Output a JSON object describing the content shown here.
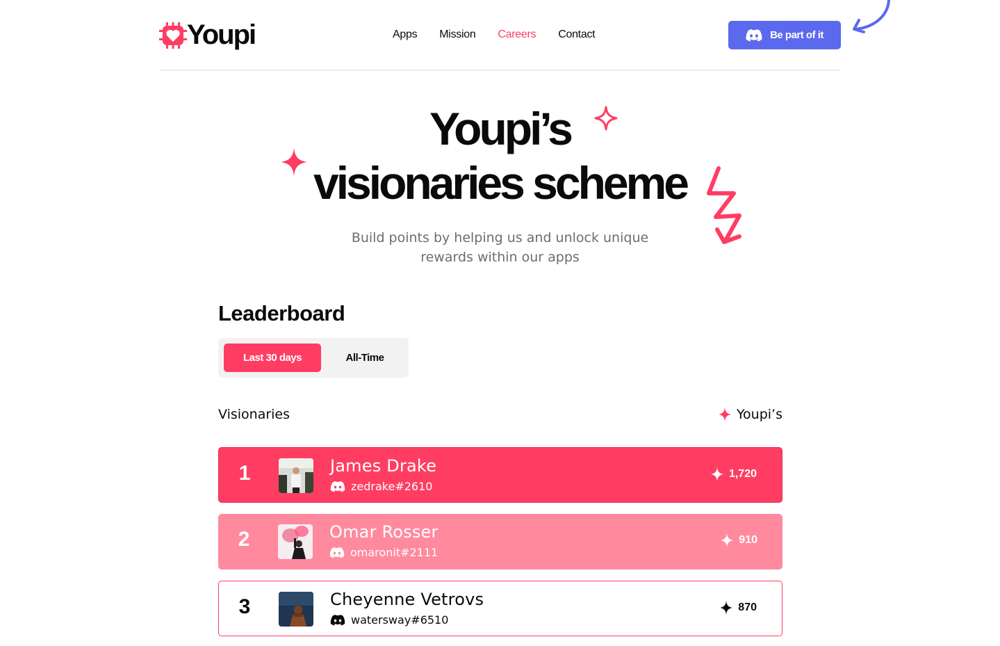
{
  "brand": {
    "name": "Youpi",
    "accent": "#ff3d63",
    "discord_color": "#5b69ee"
  },
  "nav": {
    "items": [
      {
        "label": "Apps",
        "active": false
      },
      {
        "label": "Mission",
        "active": false
      },
      {
        "label": "Careers",
        "active": true
      },
      {
        "label": "Contact",
        "active": false
      }
    ],
    "cta_label": "Be part of it",
    "cta_icon": "discord-icon"
  },
  "hero": {
    "title_line1": "Youpi’s",
    "title_line2": "visionaries scheme",
    "subtitle_line1": "Build points by helping us and unlock unique",
    "subtitle_line2": "rewards within our apps"
  },
  "leaderboard": {
    "title": "Leaderboard",
    "tabs": [
      {
        "label": "Last 30 days",
        "selected": true
      },
      {
        "label": "All-Time",
        "selected": false
      }
    ],
    "columns": {
      "left": "Visionaries",
      "right": "Youpi’s"
    },
    "rows": [
      {
        "rank": "1",
        "name": "James Drake",
        "handle": "zedrake#2610",
        "points": "1,720"
      },
      {
        "rank": "2",
        "name": "Omar Rosser",
        "handle": "omaronit#2111",
        "points": "910"
      },
      {
        "rank": "3",
        "name": "Cheyenne Vetrovs",
        "handle": "watersway#6510",
        "points": "870"
      }
    ]
  }
}
